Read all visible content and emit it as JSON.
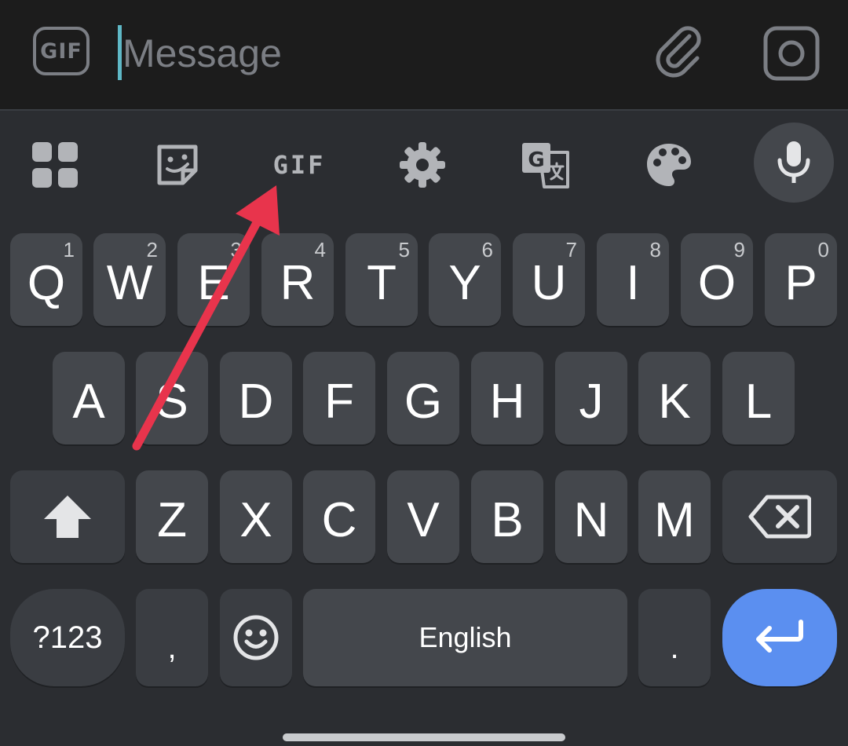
{
  "compose": {
    "gif_label": "GIF",
    "placeholder": "Message"
  },
  "toolbar": {
    "gif_label": "GIF"
  },
  "keyboard": {
    "row1": [
      {
        "label": "Q",
        "hint": "1"
      },
      {
        "label": "W",
        "hint": "2"
      },
      {
        "label": "E",
        "hint": "3"
      },
      {
        "label": "R",
        "hint": "4"
      },
      {
        "label": "T",
        "hint": "5"
      },
      {
        "label": "Y",
        "hint": "6"
      },
      {
        "label": "U",
        "hint": "7"
      },
      {
        "label": "I",
        "hint": "8"
      },
      {
        "label": "O",
        "hint": "9"
      },
      {
        "label": "P",
        "hint": "0"
      }
    ],
    "row2": [
      "A",
      "S",
      "D",
      "F",
      "G",
      "H",
      "J",
      "K",
      "L"
    ],
    "row3": [
      "Z",
      "X",
      "C",
      "V",
      "B",
      "N",
      "M"
    ],
    "symbols_label": "?123",
    "comma_label": ",",
    "space_label": "English",
    "period_label": "."
  },
  "colors": {
    "background": "#2b2d31",
    "compose_background": "#1c1c1c",
    "key": "#44474c",
    "enter_key": "#5b8ff0",
    "caret": "#5fb8c6",
    "annotation_arrow": "#e8344c"
  }
}
